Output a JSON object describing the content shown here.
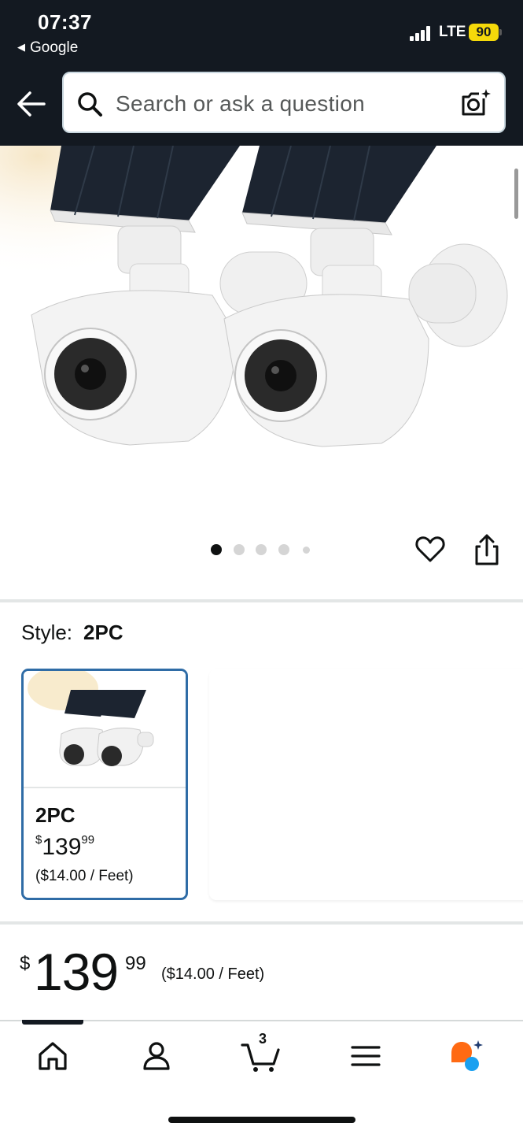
{
  "status_bar": {
    "time": "07:37",
    "back_app": "Google",
    "network": "LTE",
    "battery": "90"
  },
  "search": {
    "placeholder": "Search or ask a question"
  },
  "gallery": {
    "image_count": 5,
    "active_index": 0
  },
  "style": {
    "label": "Style:",
    "selected": "2PC",
    "options": [
      {
        "name": "2PC",
        "price_currency": "$",
        "price_whole": "139",
        "price_fraction": "99",
        "unit_price": "($14.00 / Feet)"
      }
    ]
  },
  "price": {
    "currency": "$",
    "whole": "139",
    "fraction": "99",
    "unit_price": "($14.00 / Feet)"
  },
  "bottom_nav": {
    "items": [
      {
        "name": "home",
        "icon": "home-icon"
      },
      {
        "name": "account",
        "icon": "person-icon"
      },
      {
        "name": "cart",
        "icon": "cart-icon"
      },
      {
        "name": "menu",
        "icon": "hamburger-menu-icon"
      },
      {
        "name": "rufus",
        "icon": "ai-assistant-icon"
      }
    ],
    "cart_count": "3"
  },
  "colors": {
    "header_bg": "#131921",
    "selected_border": "#2f6ca6",
    "battery": "#f5d90a",
    "assistant_orange": "#ff6a13",
    "assistant_blue": "#1aa0f0"
  }
}
